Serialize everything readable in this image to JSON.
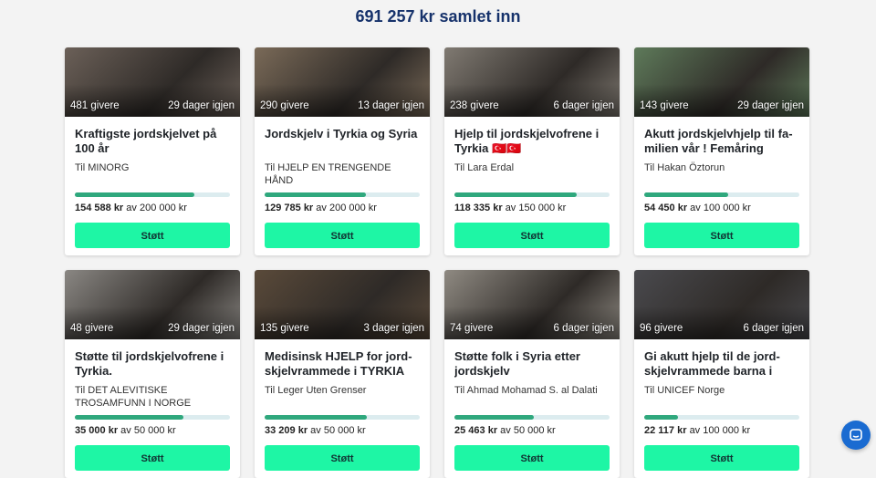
{
  "header": {
    "total": "691 257 kr samlet inn"
  },
  "cta_label": "Støtt",
  "cards": [
    {
      "givers": "481 givere",
      "days": "29 dager igjen",
      "title": "Kraftigste jordskjelvet på 100 år",
      "to": "Til MINORG",
      "raised": "154 588 kr",
      "goal": "av 200 000 kr",
      "progress": 0.77,
      "img": "#6b6058"
    },
    {
      "givers": "290 givere",
      "days": "13 dager igjen",
      "title": "Jordskjelv i Tyrkia og Syria",
      "to": "Til HJELP EN TRENGENDE HÅND",
      "raised": "129 785 kr",
      "goal": "av 200 000 kr",
      "progress": 0.65,
      "img": "#7a6a58"
    },
    {
      "givers": "238 givere",
      "days": "6 dager igjen",
      "title": "Hjelp til jordskjelvofrene i Tyrkia 🇹🇷🇹🇷",
      "to": "Til Lara Erdal",
      "raised": "118 335 kr",
      "goal": "av 150 000 kr",
      "progress": 0.79,
      "img": "#807a72"
    },
    {
      "givers": "143 givere",
      "days": "29 dager igjen",
      "title": "Akutt jordskjelvhjelp til fa­milien vår ! Femåring med…",
      "to": "Til Hakan Öztorun",
      "raised": "54 450 kr",
      "goal": "av 100 000 kr",
      "progress": 0.54,
      "img": "#5e7a5a"
    },
    {
      "givers": "48 givere",
      "days": "29 dager igjen",
      "title": "Støtte til jordskjelvofrene i Tyrkia.",
      "to": "Til DET ALEVITISKE TROSAMFUNN I NORGE",
      "raised": "35 000 kr",
      "goal": "av 50 000 kr",
      "progress": 0.7,
      "img": "#8a8783"
    },
    {
      "givers": "135 givere",
      "days": "3 dager igjen",
      "title": "Medisinsk HJELP for jord­skjelvrammede i TYRKIA &…",
      "to": "Til Leger Uten Grenser",
      "raised": "33 209 kr",
      "goal": "av 50 000 kr",
      "progress": 0.66,
      "img": "#5a4a3a"
    },
    {
      "givers": "74 givere",
      "days": "6 dager igjen",
      "title": "Støtte folk i Syria etter jordskjelv",
      "to": "Til Ahmad Mohamad S. al Dalati",
      "raised": "25 463 kr",
      "goal": "av 50 000 kr",
      "progress": 0.51,
      "img": "#8f8a82"
    },
    {
      "givers": "96 givere",
      "days": "6 dager igjen",
      "title": "Gi akutt hjelp til de jord­skjelvrammede barna i Syr…",
      "to": "Til UNICEF Norge",
      "raised": "22 117 kr",
      "goal": "av 100 000 kr",
      "progress": 0.22,
      "img": "#4a4a4e"
    }
  ]
}
